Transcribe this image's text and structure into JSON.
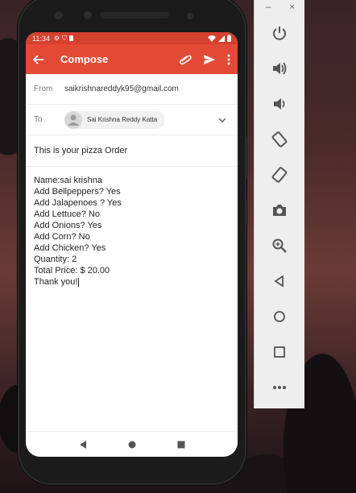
{
  "statusbar": {
    "time": "11:34"
  },
  "appbar": {
    "title": "Compose"
  },
  "from": {
    "label": "From",
    "value": "saikrishnareddyk95@gmail.com"
  },
  "to": {
    "label": "To",
    "recipient": "Sai Krishna Reddy Katta"
  },
  "subject": {
    "value": "This is your pizza Order"
  },
  "body": {
    "lines": [
      "Name:sai krishna",
      "Add Bellpeppers? Yes",
      "Add Jalapenoes ? Yes",
      "Add Lettuce? No",
      "Add Onions? Yes",
      "Add Corn? No",
      "Add Chicken? Yes",
      "Quantity: 2",
      "Total Price: $ 20.00",
      "Thank you!"
    ]
  },
  "emulator_panel": {
    "minimize_label": "–",
    "close_label": "×",
    "tools": [
      "power-icon",
      "volume-up-icon",
      "volume-down-icon",
      "rotate-left-icon",
      "rotate-right-icon",
      "camera-icon",
      "zoom-icon",
      "back-icon",
      "home-icon",
      "overview-icon",
      "more-icon"
    ]
  },
  "colors": {
    "accent": "#e34a36",
    "statusbar": "#d6402f"
  }
}
